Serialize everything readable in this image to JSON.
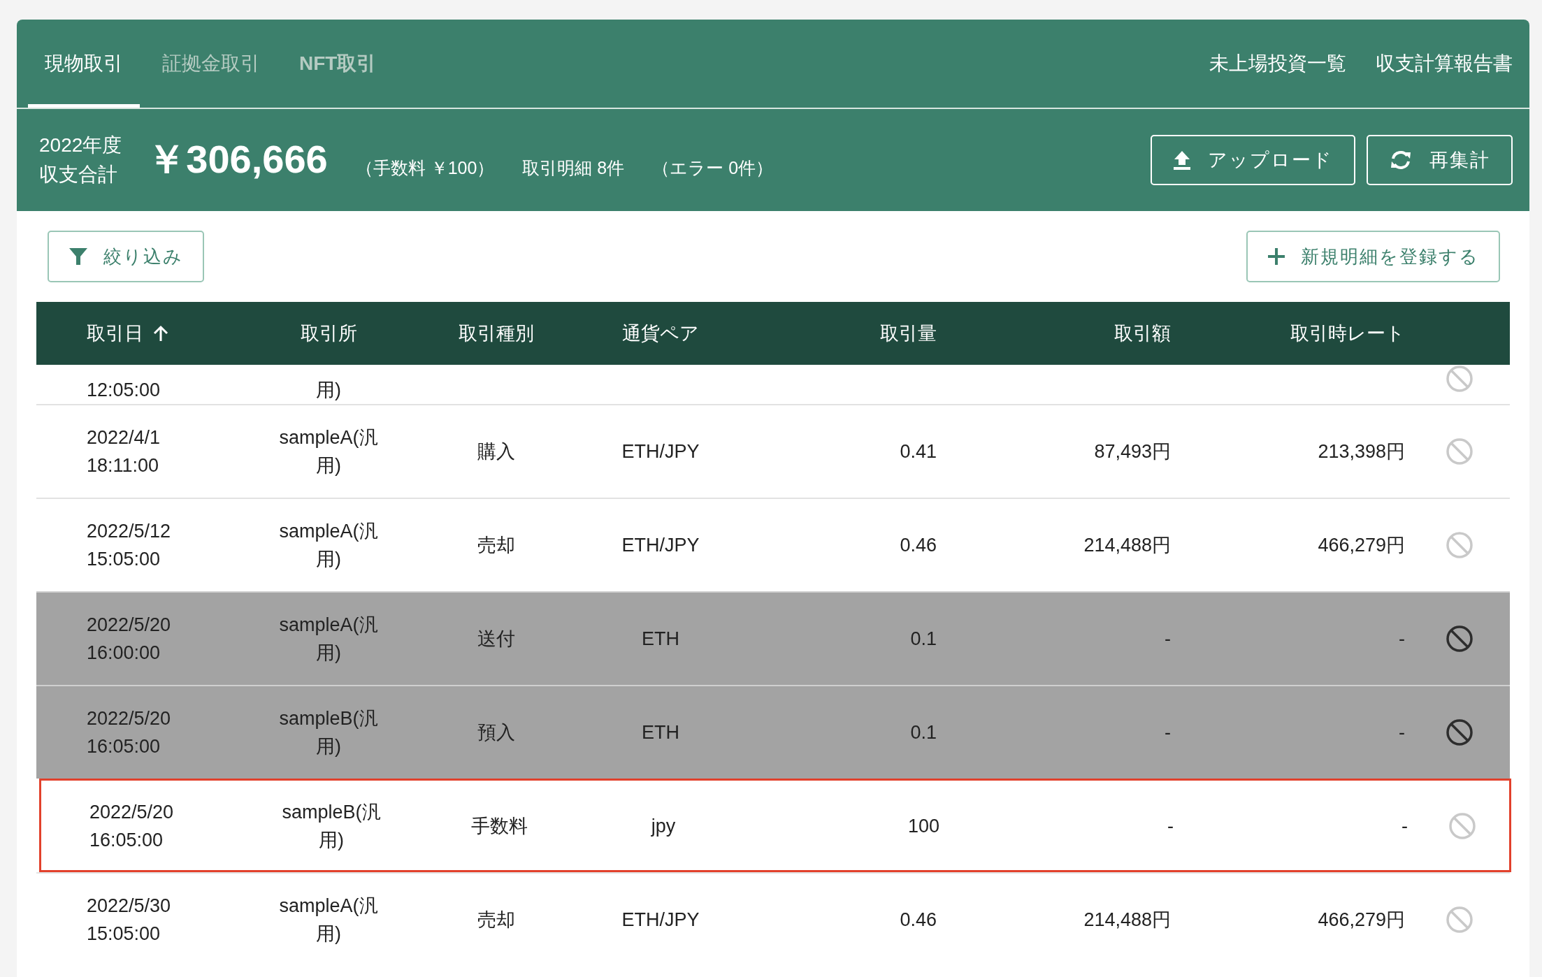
{
  "tabs": [
    {
      "label": "現物取引",
      "selected": true
    },
    {
      "label": "証拠金取引",
      "selected": false
    },
    {
      "label": "NFT取引",
      "selected": false
    }
  ],
  "header_links": [
    "未上場投資一覧",
    "収支計算報告書"
  ],
  "summary": {
    "year": "2022年度",
    "label": "収支合計",
    "total": "￥306,666",
    "fee": "（手数料 ￥100）",
    "count": "取引明細 8件",
    "errors": "（エラー 0件）"
  },
  "summary_buttons": [
    {
      "label": "アップロード",
      "kind": "upload"
    },
    {
      "label": "再集計",
      "kind": "refresh"
    }
  ],
  "filter_button": "絞り込み",
  "add_button": "新規明細を登録する",
  "table": {
    "columns": [
      {
        "label": "取引日",
        "sorted": true
      },
      {
        "label": "取引所",
        "sorted": false
      },
      {
        "label": "取引種別",
        "sorted": false
      },
      {
        "label": "通貨ペア",
        "sorted": false
      },
      {
        "label": "取引量",
        "sorted": false
      },
      {
        "label": "取引額",
        "sorted": false
      },
      {
        "label": "取引時レート",
        "sorted": false
      }
    ],
    "rows": [
      {
        "kind": "partial",
        "time": "12:05:00",
        "exchange": "用)"
      },
      {
        "kind": "full",
        "date": "2022/4/1",
        "time": "18:11:00",
        "exchange": "sampleA(汎用)",
        "type": "購入",
        "pair": "ETH/JPY",
        "amount": "0.41",
        "value": "87,493円",
        "rate": "213,398円",
        "excluded": false,
        "highlighted": false
      },
      {
        "kind": "full",
        "date": "2022/5/12",
        "time": "15:05:00",
        "exchange": "sampleA(汎用)",
        "type": "売却",
        "pair": "ETH/JPY",
        "amount": "0.46",
        "value": "214,488円",
        "rate": "466,279円",
        "excluded": false,
        "highlighted": false
      },
      {
        "kind": "full",
        "date": "2022/5/20",
        "time": "16:00:00",
        "exchange": "sampleA(汎用)",
        "type": "送付",
        "pair": "ETH",
        "amount": "0.1",
        "value": "-",
        "rate": "-",
        "excluded": true,
        "highlighted": false
      },
      {
        "kind": "full",
        "date": "2022/5/20",
        "time": "16:05:00",
        "exchange": "sampleB(汎用)",
        "type": "預入",
        "pair": "ETH",
        "amount": "0.1",
        "value": "-",
        "rate": "-",
        "excluded": true,
        "highlighted": false
      },
      {
        "kind": "full",
        "date": "2022/5/20",
        "time": "16:05:00",
        "exchange": "sampleB(汎用)",
        "type": "手数料",
        "pair": "jpy",
        "amount": "100",
        "value": "-",
        "rate": "-",
        "excluded": false,
        "highlighted": true
      },
      {
        "kind": "full",
        "date": "2022/5/30",
        "time": "15:05:00",
        "exchange": "sampleA(汎用)",
        "type": "売却",
        "pair": "ETH/JPY",
        "amount": "0.46",
        "value": "214,488円",
        "rate": "466,279円",
        "excluded": false,
        "highlighted": false
      }
    ]
  }
}
